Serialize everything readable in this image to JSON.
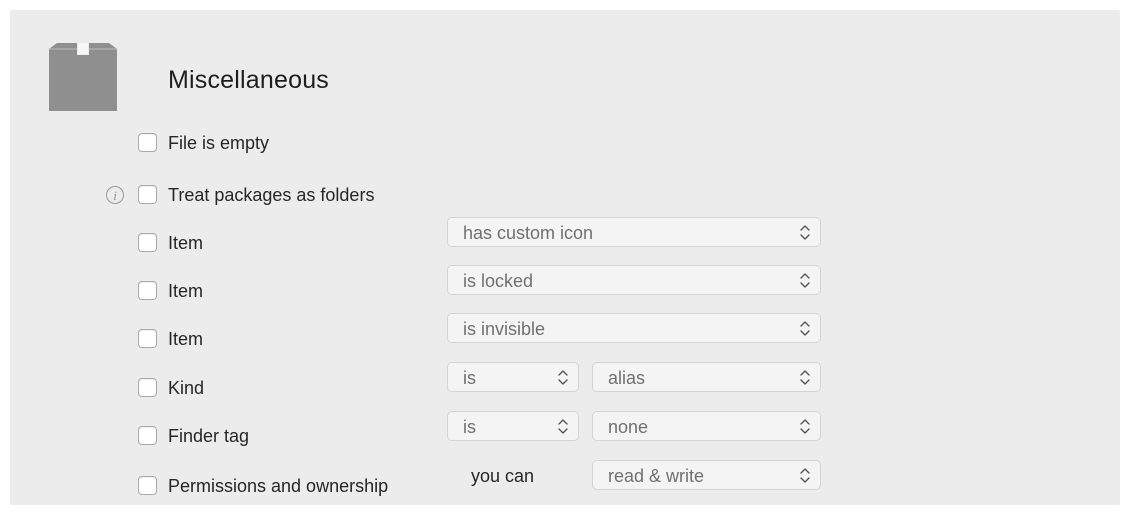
{
  "section": {
    "title": "Miscellaneous",
    "icon": "package-box-icon"
  },
  "rows": [
    {
      "label": "File is empty",
      "checked": false
    },
    {
      "label": "Treat packages as folders",
      "checked": false,
      "info_icon": "info-icon"
    },
    {
      "label": "Item",
      "checked": false,
      "popup": "has custom icon"
    },
    {
      "label": "Item",
      "checked": false,
      "popup": "is locked"
    },
    {
      "label": "Item",
      "checked": false,
      "popup": "is invisible"
    },
    {
      "label": "Kind",
      "checked": false,
      "operator": "is",
      "popup": "alias"
    },
    {
      "label": "Finder tag",
      "checked": false,
      "operator": "is",
      "popup": "none"
    },
    {
      "label": "Permissions and ownership",
      "checked": false,
      "text": "you can",
      "popup": "read & write"
    }
  ],
  "info_glyph": "i",
  "colors": {
    "panel_bg": "#ececec",
    "popup_bg": "#f4f4f4",
    "popup_text": "#707070",
    "icon_gray": "#8d8d8d"
  }
}
